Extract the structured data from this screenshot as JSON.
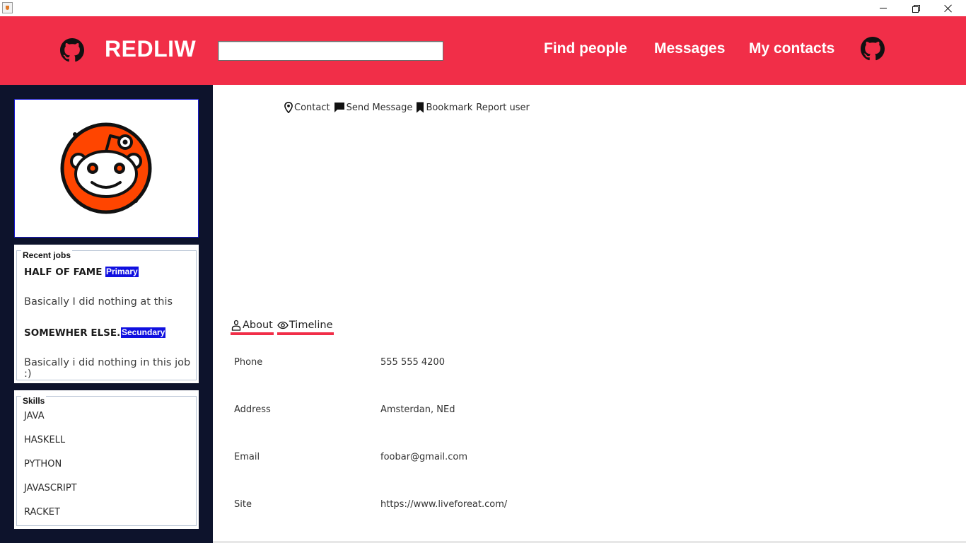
{
  "window": {
    "icon": "java-icon",
    "controls": [
      "minimize",
      "restore",
      "close"
    ]
  },
  "header": {
    "brand": "REDLIW",
    "search": {
      "value": "",
      "placeholder": ""
    },
    "nav": {
      "find_people": "Find people",
      "messages": "Messages",
      "my_contacts": "My contacts"
    },
    "left_icon": "github-icon",
    "right_icon": "github-icon",
    "colors": {
      "header_bg": "#f12e48",
      "sidebar_bg": "#0d132c",
      "tag_bg": "#1010e0"
    }
  },
  "sidebar": {
    "avatar": "reddit-alien-avatar",
    "recent_jobs": {
      "legend": "Recent jobs",
      "items": [
        {
          "title": "HALF OF FAME",
          "tag": "Primary",
          "description": "Basically I did nothing at this"
        },
        {
          "title": "SOMEWHER ELSE..",
          "tag": "Secundary",
          "description": "Basically i did nothing in this job :)"
        }
      ]
    },
    "skills": {
      "legend": "Skills",
      "items": [
        "JAVA",
        "HASKELL",
        "PYTHON",
        "JAVASCRIPT",
        "RACKET"
      ]
    }
  },
  "main": {
    "actions": {
      "contact": "Contact",
      "send_message": "Send Message",
      "bookmark": "Bookmark",
      "report": "Report user"
    },
    "tabs": {
      "about": "About",
      "timeline": "Timeline"
    },
    "info": [
      {
        "label": "Phone",
        "value": "555 555 4200"
      },
      {
        "label": "Address",
        "value": "Amsterdan, NEd"
      },
      {
        "label": "Email",
        "value": "foobar@gmail.com"
      },
      {
        "label": "Site",
        "value": "https://www.liveforeat.com/"
      }
    ]
  }
}
